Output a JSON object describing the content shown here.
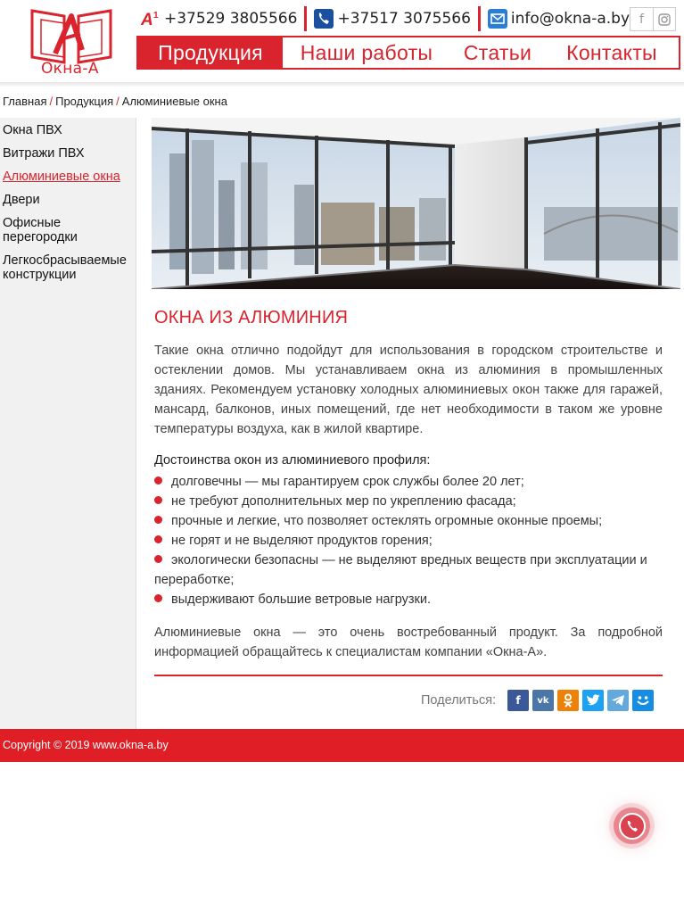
{
  "header": {
    "logo_text": "Окна-А",
    "phone_a1": "+37529 3805566",
    "phone_city": "+37517 3075566",
    "email": "info@okna-a.by",
    "social": [
      "f",
      "instagram"
    ]
  },
  "nav": {
    "items": [
      "Продукция",
      "Наши работы",
      "Статьи",
      "Контакты"
    ],
    "active": "Продукция"
  },
  "breadcrumb": [
    "Главная",
    "Продукция",
    "Алюминиевые окна"
  ],
  "sidebar": {
    "items": [
      "Окна ПВХ",
      "Витражи ПВХ",
      "Алюминиевые окна",
      "Двери",
      "Офисные перегородки",
      "Легкосбрасываемые конструкции"
    ],
    "active": "Алюминиевые окна"
  },
  "content": {
    "title": "ОКНА ИЗ АЛЮМИНИЯ",
    "intro": "Такие окна отлично подойдут для использования в городском строительстве и остеклении домов. Мы устанавливаем окна из алюминия в промышленных зданиях. Рекомендуем установку холодных алюминиевых окон также для гаражей, мансард, балконов, иных помещений, где нет необходимости в таком же уровне температуры воздуха, как в жилой квартире.",
    "advantages_title": "Достоинства окон из алюминиевого профиля:",
    "advantages": [
      "долговечны — мы гарантируем срок службы более 20 лет;",
      "не требуют дополнительных мер по укреплению фасада;",
      "прочные и легкие, что позволяет остеклять огромные оконные проемы;",
      "не горят и не выделяют продуктов горения;",
      "экологически безопасны — не выделяют вредных веществ при эксплуатации и переработке;",
      "выдерживают большие ветровые нагрузки."
    ],
    "outro": "Алюминиевые окна — это очень востребованный продукт. За подробной информацией обращайтесь к специалистам компании «Окна-А».",
    "share_label": "Поделиться:",
    "share_buttons": [
      "facebook",
      "vk",
      "odnoklassniki",
      "twitter",
      "telegram",
      "moimir"
    ]
  },
  "footer": {
    "copyright": "Copyright © 2019 www.okna-a.by"
  },
  "colors": {
    "brand_red": "#d9232d",
    "footer_red": "#e01e26"
  }
}
